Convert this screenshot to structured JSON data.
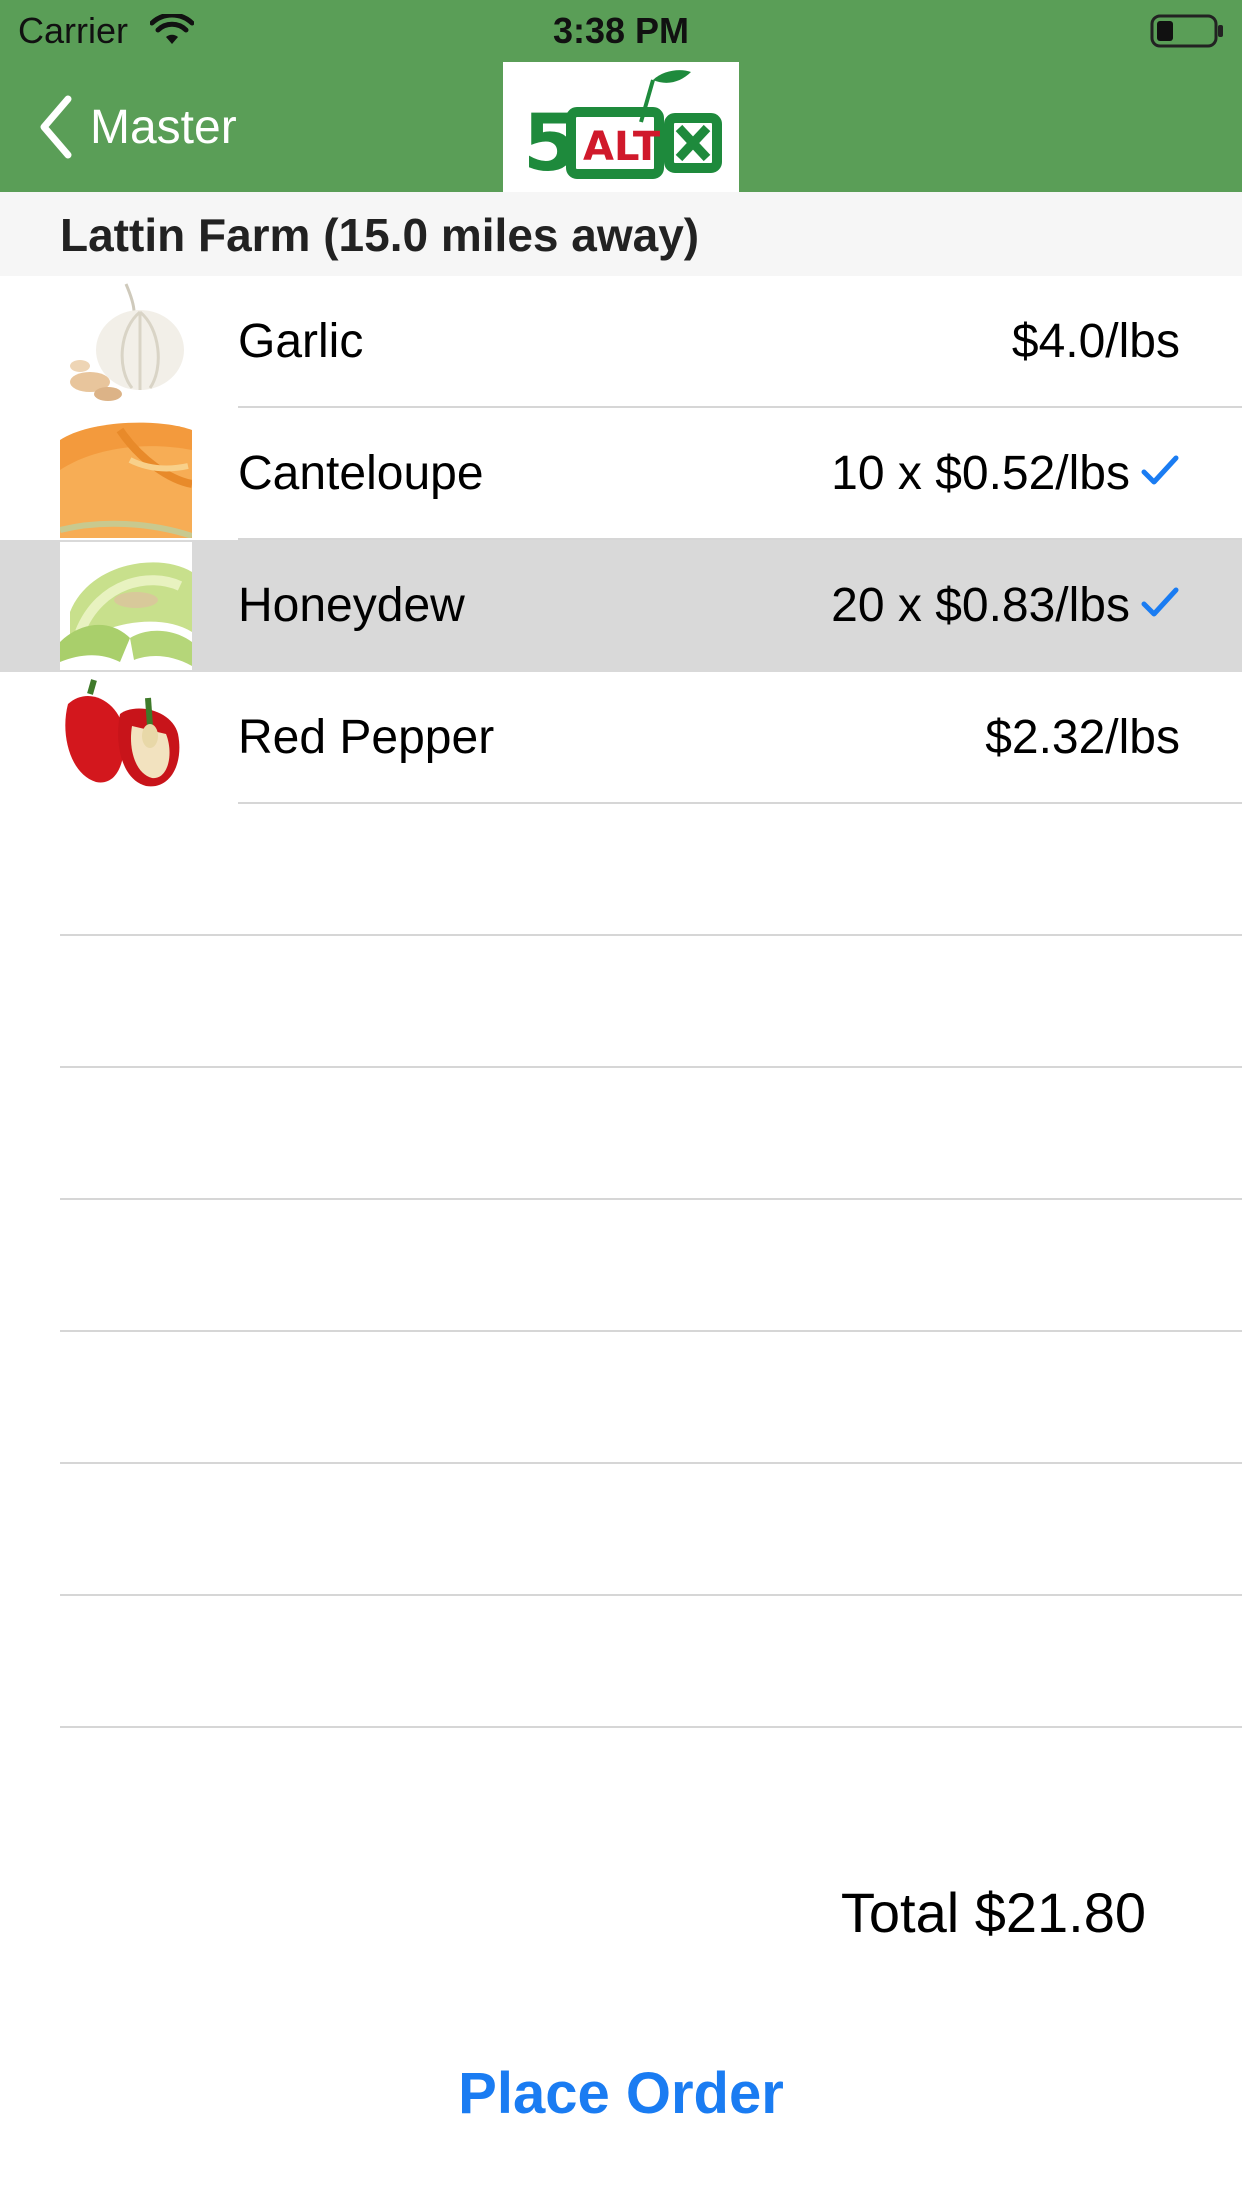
{
  "status_bar": {
    "carrier": "Carrier",
    "time": "3:38 PM"
  },
  "nav_bar": {
    "back_label": "Master",
    "logo_text": "ALT",
    "logo_number": "5"
  },
  "section": {
    "title": "Lattin Farm (15.0 miles away)"
  },
  "items": [
    {
      "name": "Garlic",
      "price": "$4.0/lbs",
      "selected": false,
      "checked": false,
      "icon": "garlic-image"
    },
    {
      "name": "Canteloupe",
      "price": "10 x $0.52/lbs",
      "selected": false,
      "checked": true,
      "icon": "canteloupe-image"
    },
    {
      "name": "Honeydew",
      "price": "20 x $0.83/lbs",
      "selected": true,
      "checked": true,
      "icon": "honeydew-image"
    },
    {
      "name": "Red Pepper",
      "price": "$2.32/lbs",
      "selected": false,
      "checked": false,
      "icon": "red-pepper-image"
    }
  ],
  "footer": {
    "total": "Total $21.80",
    "place_order": "Place Order"
  },
  "colors": {
    "nav_green": "#5a9e57",
    "accent_blue": "#1a7cf2",
    "logo_green": "#1e8a3c",
    "logo_red": "#d0192b"
  }
}
